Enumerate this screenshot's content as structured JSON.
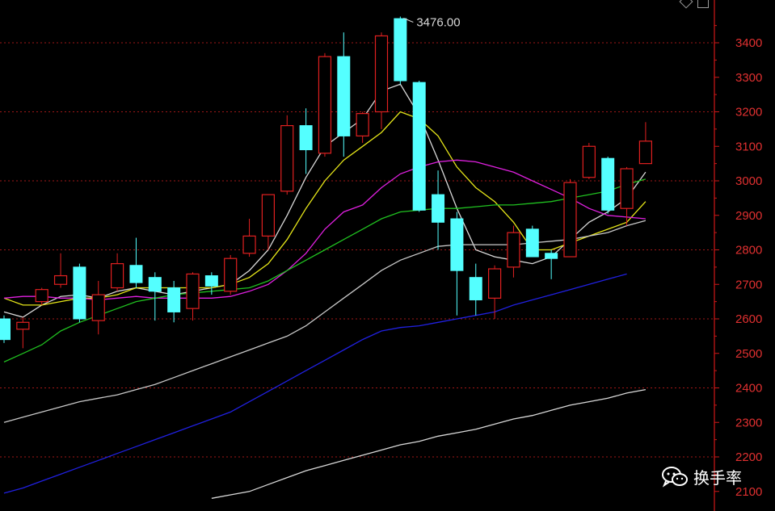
{
  "chart_data": {
    "type": "candlestick",
    "colors": {
      "background": "#000000",
      "up": "#e02020",
      "down": "#54ffff",
      "grid": "#a01818",
      "axis": "#d01818"
    },
    "ylim": [
      2080,
      3490
    ],
    "y_ticks": [
      2100,
      2200,
      2300,
      2400,
      2500,
      2600,
      2700,
      2800,
      2900,
      3000,
      3100,
      3200,
      3300,
      3400
    ],
    "grid_levels": [
      2200,
      2400,
      2600,
      2800,
      3000,
      3200,
      3400
    ],
    "peak_label": "3476.00",
    "peak_value": 3476,
    "candles": [
      {
        "o": 2600,
        "h": 2610,
        "l": 2530,
        "c": 2540
      },
      {
        "o": 2570,
        "h": 2605,
        "l": 2515,
        "c": 2590
      },
      {
        "o": 2650,
        "h": 2690,
        "l": 2640,
        "c": 2685
      },
      {
        "o": 2700,
        "h": 2790,
        "l": 2690,
        "c": 2725
      },
      {
        "o": 2750,
        "h": 2760,
        "l": 2590,
        "c": 2600
      },
      {
        "o": 2595,
        "h": 2710,
        "l": 2555,
        "c": 2670
      },
      {
        "o": 2690,
        "h": 2790,
        "l": 2680,
        "c": 2760
      },
      {
        "o": 2755,
        "h": 2835,
        "l": 2690,
        "c": 2705
      },
      {
        "o": 2720,
        "h": 2735,
        "l": 2595,
        "c": 2680
      },
      {
        "o": 2690,
        "h": 2710,
        "l": 2590,
        "c": 2620
      },
      {
        "o": 2630,
        "h": 2735,
        "l": 2595,
        "c": 2730
      },
      {
        "o": 2725,
        "h": 2735,
        "l": 2670,
        "c": 2695
      },
      {
        "o": 2680,
        "h": 2785,
        "l": 2670,
        "c": 2775
      },
      {
        "o": 2790,
        "h": 2890,
        "l": 2780,
        "c": 2840
      },
      {
        "o": 2840,
        "h": 2960,
        "l": 2800,
        "c": 2960
      },
      {
        "o": 2970,
        "h": 3190,
        "l": 2960,
        "c": 3160
      },
      {
        "o": 3160,
        "h": 3210,
        "l": 3020,
        "c": 3090
      },
      {
        "o": 3080,
        "h": 3370,
        "l": 3070,
        "c": 3360
      },
      {
        "o": 3360,
        "h": 3430,
        "l": 3070,
        "c": 3130
      },
      {
        "o": 3130,
        "h": 3200,
        "l": 3110,
        "c": 3195
      },
      {
        "o": 3200,
        "h": 3430,
        "l": 3150,
        "c": 3420
      },
      {
        "o": 3470,
        "h": 3476,
        "l": 3280,
        "c": 3290
      },
      {
        "o": 3285,
        "h": 3290,
        "l": 2910,
        "c": 2915
      },
      {
        "o": 2960,
        "h": 3030,
        "l": 2800,
        "c": 2880
      },
      {
        "o": 2890,
        "h": 2910,
        "l": 2610,
        "c": 2740
      },
      {
        "o": 2720,
        "h": 2760,
        "l": 2610,
        "c": 2655
      },
      {
        "o": 2660,
        "h": 2755,
        "l": 2600,
        "c": 2745
      },
      {
        "o": 2750,
        "h": 2870,
        "l": 2720,
        "c": 2850
      },
      {
        "o": 2860,
        "h": 2870,
        "l": 2780,
        "c": 2780
      },
      {
        "o": 2790,
        "h": 2800,
        "l": 2715,
        "c": 2775
      },
      {
        "o": 2780,
        "h": 3005,
        "l": 2780,
        "c": 2995
      },
      {
        "o": 3010,
        "h": 3110,
        "l": 3005,
        "c": 3100
      },
      {
        "o": 3065,
        "h": 3070,
        "l": 2905,
        "c": 2915
      },
      {
        "o": 2920,
        "h": 3040,
        "l": 2870,
        "c": 3035
      },
      {
        "o": 3050,
        "h": 3170,
        "l": 3050,
        "c": 3115
      }
    ],
    "moving_averages": [
      {
        "color": "#d8d8d8",
        "values": [
          2620,
          2605,
          2640,
          2665,
          2670,
          2660,
          2680,
          2690,
          2680,
          2670,
          2680,
          2690,
          2700,
          2740,
          2800,
          2900,
          3010,
          3100,
          3140,
          3180,
          3260,
          3280,
          3190,
          3060,
          2920,
          2800,
          2780,
          2770,
          2760,
          2780,
          2830,
          2880,
          2910,
          2950,
          3025
        ]
      },
      {
        "color": "#e6e619",
        "values": [
          2660,
          2640,
          2640,
          2650,
          2660,
          2660,
          2670,
          2690,
          2690,
          2690,
          2690,
          2690,
          2700,
          2720,
          2760,
          2830,
          2920,
          3000,
          3060,
          3100,
          3140,
          3200,
          3180,
          3130,
          3040,
          2980,
          2940,
          2880,
          2800,
          2800,
          2820,
          2840,
          2860,
          2880,
          2940
        ]
      },
      {
        "color": "#e020e0",
        "values": [
          2660,
          2665,
          2665,
          2660,
          2660,
          2655,
          2660,
          2665,
          2660,
          2660,
          2660,
          2660,
          2665,
          2680,
          2700,
          2740,
          2790,
          2860,
          2910,
          2930,
          2980,
          3020,
          3040,
          3055,
          3060,
          3055,
          3040,
          3025,
          3000,
          2975,
          2950,
          2920,
          2900,
          2895,
          2890
        ]
      },
      {
        "color": "#20c020",
        "values": [
          2475,
          2500,
          2525,
          2565,
          2590,
          2610,
          2630,
          2650,
          2660,
          2670,
          2675,
          2680,
          2685,
          2690,
          2710,
          2740,
          2770,
          2800,
          2830,
          2860,
          2890,
          2910,
          2915,
          2920,
          2920,
          2925,
          2930,
          2930,
          2935,
          2940,
          2950,
          2960,
          2970,
          2990,
          3005
        ]
      },
      {
        "color": "#c8c8c8",
        "values": [
          2300,
          2315,
          2330,
          2345,
          2360,
          2370,
          2380,
          2395,
          2410,
          2430,
          2450,
          2470,
          2490,
          2510,
          2530,
          2550,
          2580,
          2620,
          2660,
          2700,
          2740,
          2770,
          2790,
          2810,
          2815,
          2815,
          2815,
          2815,
          2820,
          2825,
          2830,
          2840,
          2850,
          2870,
          2885
        ]
      },
      {
        "color": "#2020e0",
        "values": [
          2095,
          2110,
          2130,
          2150,
          2170,
          2190,
          2210,
          2230,
          2250,
          2270,
          2290,
          2310,
          2330,
          2360,
          2390,
          2420,
          2450,
          2480,
          2510,
          2540,
          2565,
          2575,
          2580,
          2590,
          2600,
          2610,
          2620,
          2640,
          2655,
          2670,
          2685,
          2700,
          2715,
          2730
        ]
      },
      {
        "color": "#d8d8d8",
        "start_index": 11,
        "values": [
          2080,
          2090,
          2100,
          2120,
          2140,
          2160,
          2175,
          2190,
          2205,
          2220,
          2235,
          2245,
          2260,
          2270,
          2280,
          2295,
          2310,
          2320,
          2335,
          2350,
          2360,
          2370,
          2385,
          2395
        ]
      }
    ]
  },
  "watermark": {
    "text": "换手率",
    "icon": "wechat-icon"
  },
  "toolbar_icons": [
    "diamond-icon",
    "square-icon"
  ]
}
